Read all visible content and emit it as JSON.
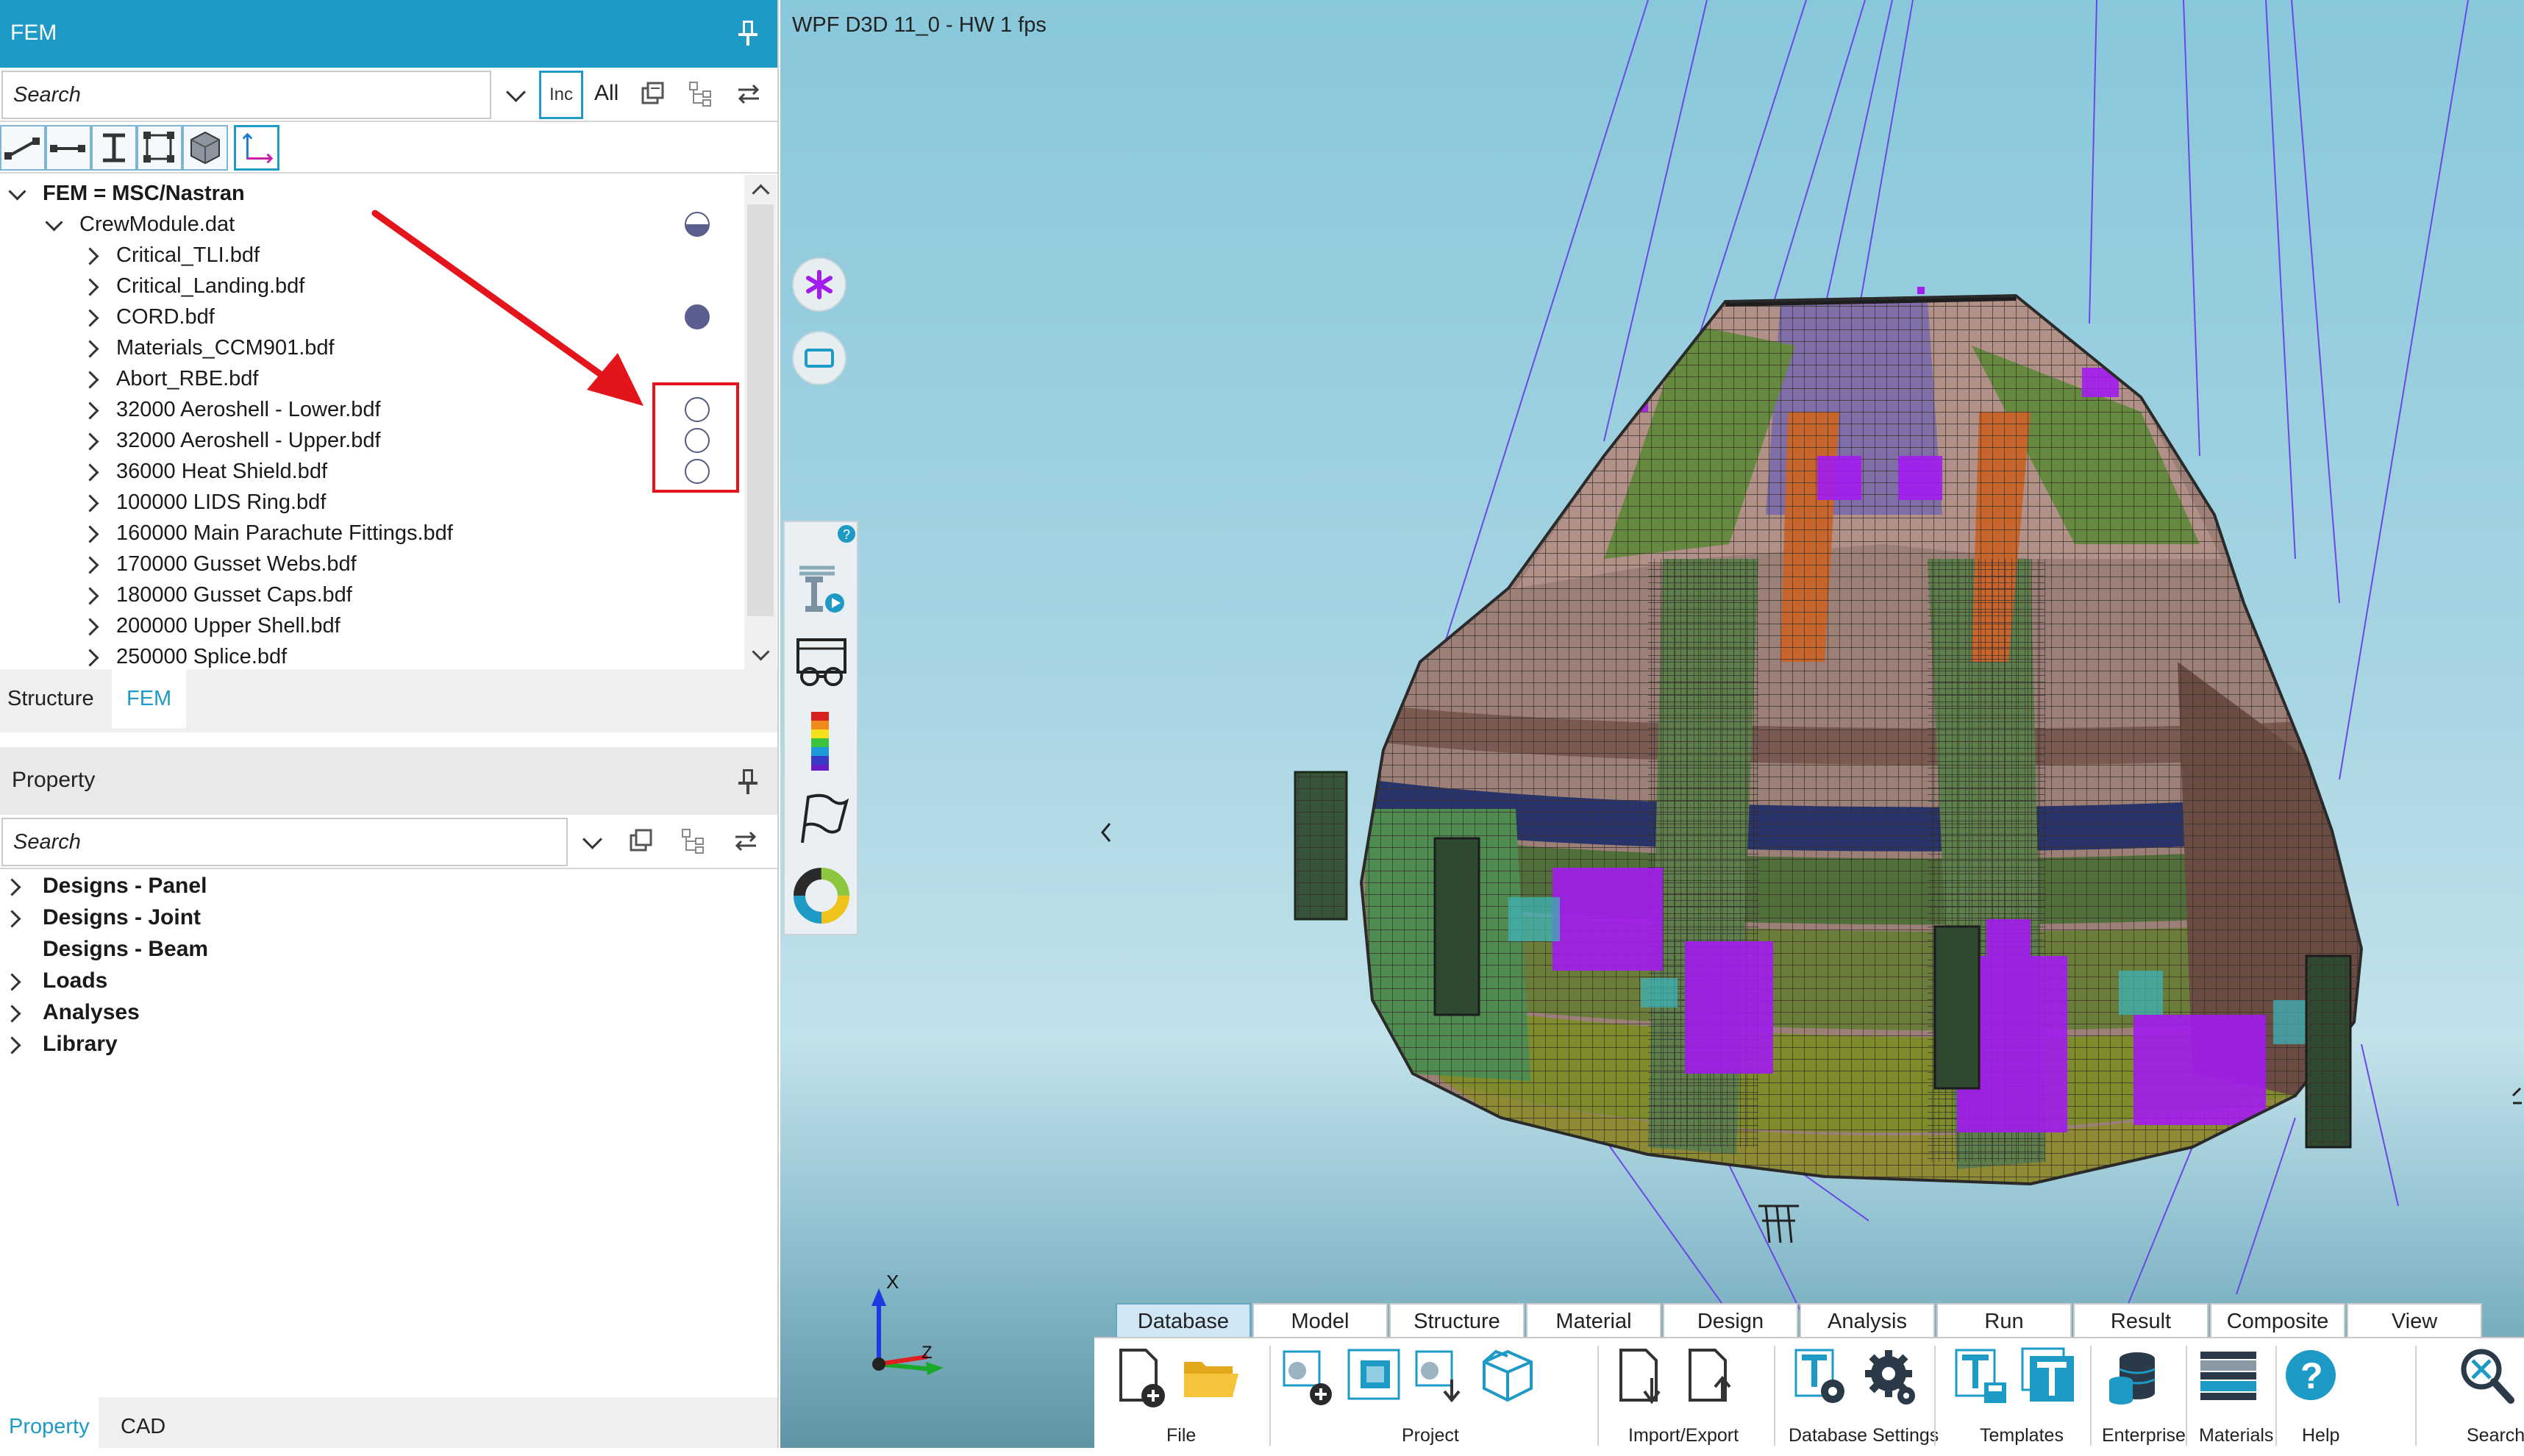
{
  "fem_panel": {
    "title": "FEM",
    "search": {
      "placeholder": "Search"
    },
    "inc_label": "Inc",
    "all_label": "All",
    "tree": [
      {
        "label": "FEM = MSC/Nastran",
        "bold": true,
        "status": ""
      },
      {
        "label": "CrewModule.dat",
        "status": "half"
      },
      {
        "label": "Critical_TLI.bdf",
        "status": ""
      },
      {
        "label": "Critical_Landing.bdf",
        "status": ""
      },
      {
        "label": "CORD.bdf",
        "status": "full"
      },
      {
        "label": "Materials_CCM901.bdf",
        "status": ""
      },
      {
        "label": "Abort_RBE.bdf",
        "status": ""
      },
      {
        "label": "32000 Aeroshell - Lower.bdf",
        "status": "empty"
      },
      {
        "label": "32000 Aeroshell - Upper.bdf",
        "status": "empty"
      },
      {
        "label": "36000 Heat Shield.bdf",
        "status": "empty"
      },
      {
        "label": "100000 LIDS Ring.bdf",
        "status": ""
      },
      {
        "label": "160000 Main Parachute Fittings.bdf",
        "status": ""
      },
      {
        "label": "170000 Gusset Webs.bdf",
        "status": ""
      },
      {
        "label": "180000 Gusset Caps.bdf",
        "status": ""
      },
      {
        "label": "200000 Upper Shell.bdf",
        "status": ""
      },
      {
        "label": "250000 Splice.bdf",
        "status": ""
      }
    ],
    "tabs": [
      {
        "label": "Structure"
      },
      {
        "label": "FEM",
        "active": true
      }
    ]
  },
  "property_panel": {
    "title": "Property",
    "search": {
      "placeholder": "Search"
    },
    "tree": [
      {
        "label": "Designs - Panel"
      },
      {
        "label": "Designs - Joint"
      },
      {
        "label": "Designs - Beam"
      },
      {
        "label": "Loads"
      },
      {
        "label": "Analyses"
      },
      {
        "label": "Library"
      }
    ],
    "tabs": [
      {
        "label": "Property",
        "active": true
      },
      {
        "label": "CAD"
      }
    ]
  },
  "viewport": {
    "title": "WPF D3D 11_0 - HW  1 fps",
    "axis_labels": {
      "x": "X",
      "z": "Z"
    }
  },
  "ribbon": {
    "tabs": [
      "Database",
      "Model",
      "Structure",
      "Material",
      "Design",
      "Analysis",
      "Run",
      "Result",
      "Composite",
      "View"
    ],
    "active_tab": "Database",
    "groups": [
      "File",
      "Project",
      "Import/Export",
      "Database Settings",
      "Templates",
      "Enterprise",
      "Materials",
      "Help",
      "Search"
    ]
  },
  "colors": {
    "accent": "#1e9ac6",
    "annotation": "#e3141b",
    "status_fill": "#5a5f8f",
    "mesh_magenta": "#a21cf0"
  }
}
